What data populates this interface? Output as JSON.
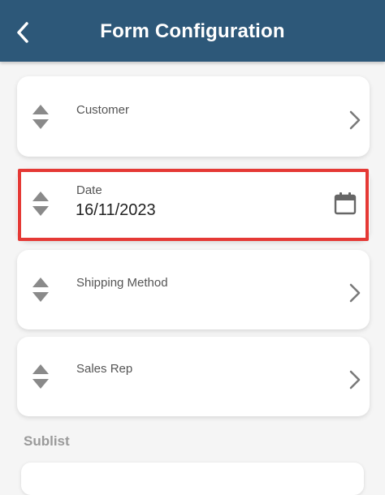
{
  "header": {
    "title": "Form Configuration",
    "back_icon": "chevron-left-icon"
  },
  "fields": [
    {
      "label": "Customer",
      "trailing_icon": "chevron-right-icon"
    },
    {
      "label": "Date",
      "value": "16/11/2023",
      "trailing_icon": "calendar-icon",
      "highlighted": true
    },
    {
      "label": "Shipping Method",
      "trailing_icon": "chevron-right-icon"
    },
    {
      "label": "Sales Rep",
      "trailing_icon": "chevron-right-icon"
    }
  ],
  "sublist": {
    "heading": "Sublist"
  },
  "colors": {
    "header_bg": "#2d5879",
    "highlight": "#e53935",
    "icon_gray": "#8a8a8a"
  }
}
